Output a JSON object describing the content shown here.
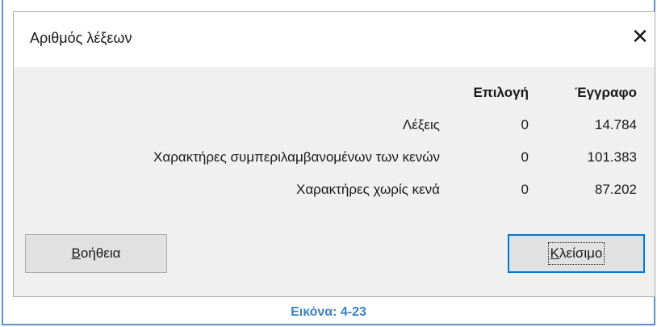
{
  "dialog": {
    "title": "Αριθμός λέξεων",
    "close_glyph": "✕",
    "columns": {
      "selection": "Επιλογή",
      "document": "Έγγραφο"
    },
    "rows": [
      {
        "label": "Λέξεις",
        "selection": "0",
        "document": "14.784"
      },
      {
        "label": "Χαρακτήρες συμπεριλαμβανομένων των κενών",
        "selection": "0",
        "document": "101.383"
      },
      {
        "label": "Χαρακτήρες χωρίς κενά",
        "selection": "0",
        "document": "87.202"
      }
    ],
    "buttons": {
      "help_mnemonic": "Β",
      "help_rest": "οήθεια",
      "close_mnemonic": "Κ",
      "close_rest": "λείσιμο"
    }
  },
  "caption": "Εικόνα: 4-23",
  "colors": {
    "dialog_bg": "#f0f0f0",
    "focus_border": "#0078d7",
    "caption": "#3c80c4"
  }
}
